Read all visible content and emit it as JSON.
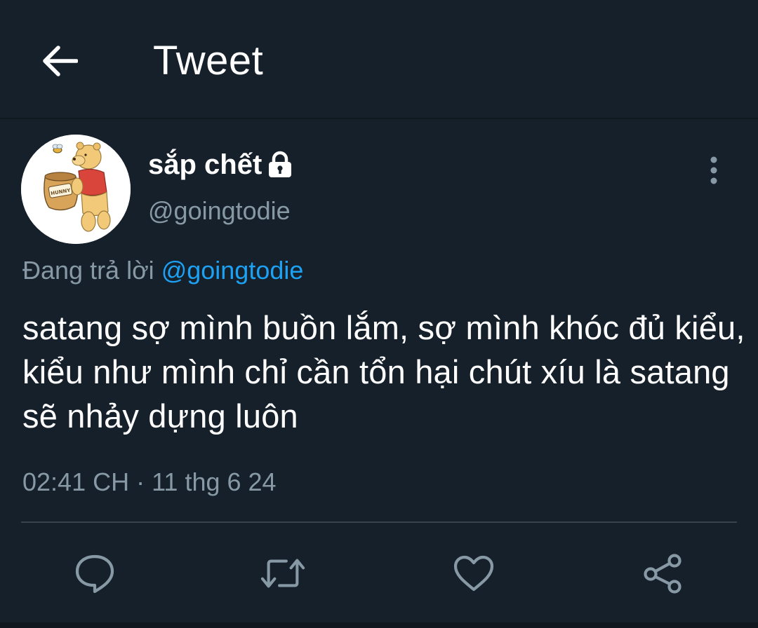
{
  "header": {
    "title": "Tweet",
    "back_icon": "arrow-left-icon"
  },
  "author": {
    "display_name": "sắp chết",
    "handle": "@goingtodie",
    "protected_icon": "lock-icon",
    "avatar": "winnie-the-pooh-honey-pot",
    "avatar_text": "HUNNY"
  },
  "reply_context": {
    "prefix": "Đang trả lời ",
    "mention": "@goingtodie"
  },
  "tweet": {
    "text": "satang sợ mình buồn lắm, sợ mình khóc đủ kiểu, kiểu như mình chỉ cần tổn hại chút xíu là satang sẽ nhảy dựng luôn",
    "timestamp": "02:41 CH · 11 thg 6 24"
  },
  "actions": [
    {
      "name": "reply",
      "icon": "speech-bubble-icon"
    },
    {
      "name": "retweet",
      "icon": "retweet-icon"
    },
    {
      "name": "like",
      "icon": "heart-icon"
    },
    {
      "name": "share",
      "icon": "share-icon"
    }
  ],
  "colors": {
    "background": "#15202b",
    "text": "#ffffff",
    "secondary": "#8899a6",
    "link": "#1da1f2",
    "divider": "#38444d"
  }
}
